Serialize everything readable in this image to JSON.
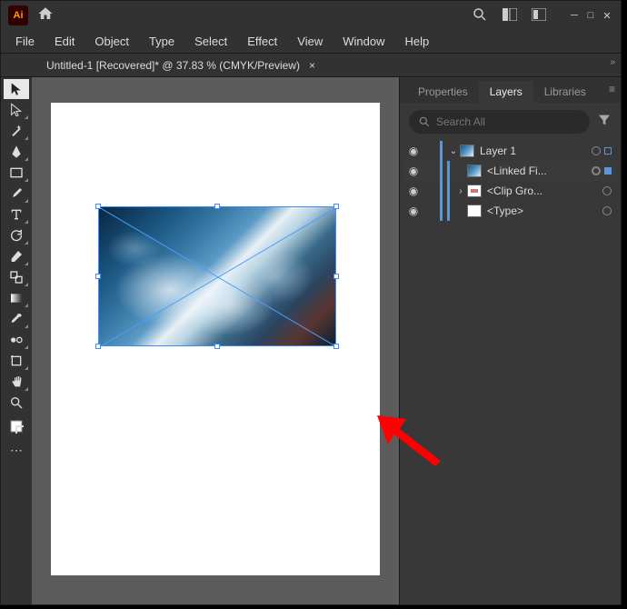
{
  "titlebar": {
    "logo": "Ai"
  },
  "menu": {
    "file": "File",
    "edit": "Edit",
    "object": "Object",
    "type": "Type",
    "select": "Select",
    "effect": "Effect",
    "view": "View",
    "window": "Window",
    "help": "Help"
  },
  "tab": {
    "title": "Untitled-1 [Recovered]* @ 37.83 % (CMYK/Preview)",
    "close": "×"
  },
  "panelTabs": {
    "properties": "Properties",
    "layers": "Layers",
    "libraries": "Libraries"
  },
  "search": {
    "placeholder": "Search All"
  },
  "layers": {
    "l1": "Layer 1",
    "l2": "<Linked Fi...",
    "l3": "<Clip Gro...",
    "l4": "<Type>"
  },
  "chart_data": null
}
